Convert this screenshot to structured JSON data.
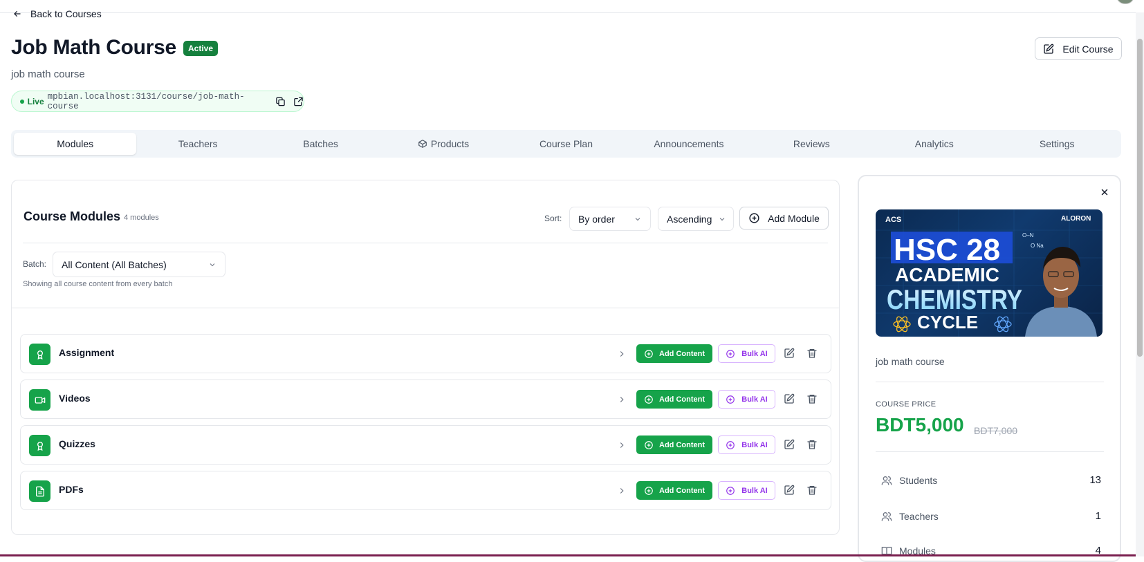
{
  "nav": {
    "back_label": "Back to Courses"
  },
  "course": {
    "title": "Job Math Course",
    "status": "Active",
    "description": "job math course",
    "live_label": "Live",
    "live_url": "mpbian.localhost:3131/course/job-math-course",
    "edit_label": "Edit Course"
  },
  "tabs": [
    {
      "label": "Modules",
      "active": true
    },
    {
      "label": "Teachers"
    },
    {
      "label": "Batches"
    },
    {
      "label": "Products",
      "icon": "box-icon"
    },
    {
      "label": "Course Plan"
    },
    {
      "label": "Announcements"
    },
    {
      "label": "Reviews"
    },
    {
      "label": "Analytics"
    },
    {
      "label": "Settings"
    }
  ],
  "modules_panel": {
    "title": "Course Modules",
    "count": "4 modules",
    "sort_label": "Sort:",
    "sort_by": "By order",
    "sort_dir": "Ascending",
    "add_module_label": "Add Module",
    "batch_label": "Batch:",
    "batch_value": "All Content (All Batches)",
    "batch_note": "Showing all course content from every batch",
    "add_content_label": "Add Content",
    "bulk_ai_label": "Bulk AI",
    "modules": [
      {
        "name": "Assignment",
        "icon": "award-icon"
      },
      {
        "name": "Videos",
        "icon": "video-icon"
      },
      {
        "name": "Quizzes",
        "icon": "award-icon"
      },
      {
        "name": "PDFs",
        "icon": "file-text-icon"
      }
    ]
  },
  "sidebar": {
    "thumb": {
      "brand_left": "ACS",
      "brand_right": "ALORON",
      "line1": "HSC 28",
      "line2": "ACADEMIC",
      "line3": "CHEMISTRY",
      "line4": "CYCLE",
      "formula1": "O–N",
      "formula2": "O Na"
    },
    "description": "job math course",
    "price_label": "COURSE PRICE",
    "price": "BDT5,000",
    "old_price": "BDT7,000",
    "stats": [
      {
        "label": "Students",
        "value": "13"
      },
      {
        "label": "Teachers",
        "value": "1"
      },
      {
        "label": "Modules",
        "value": "4"
      }
    ]
  },
  "colors": {
    "accent": "#16a34a",
    "active_badge": "#15803d",
    "bulk_ai": "#9333ea"
  }
}
